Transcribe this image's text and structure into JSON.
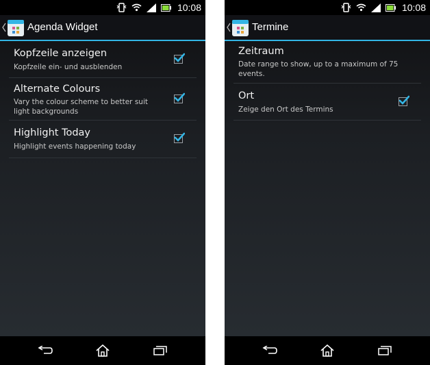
{
  "status_bar": {
    "time": "10:08"
  },
  "left_screen": {
    "title": "Agenda Widget",
    "items": [
      {
        "title": "Kopfzeile anzeigen",
        "subtitle": "Kopfzeile ein- und ausblenden",
        "checked": true
      },
      {
        "title": "Alternate Colours",
        "subtitle": "Vary the colour scheme to better suit light backgrounds",
        "checked": true
      },
      {
        "title": "Highlight Today",
        "subtitle": "Highlight events happening today",
        "checked": true
      }
    ]
  },
  "right_screen": {
    "title": "Termine",
    "items": [
      {
        "title": "Zeitraum",
        "subtitle": "Date range to show, up to a maximum of 75 events."
      },
      {
        "title": "Ort",
        "subtitle": "Zeige den Ort des Termins",
        "checked": true
      }
    ]
  },
  "colors": {
    "accent": "#33b5e5",
    "check": "#33b5e5"
  },
  "icons": [
    "vibrate-icon",
    "wifi-icon",
    "signal-icon",
    "battery-icon",
    "back-icon",
    "home-icon",
    "recent-apps-icon",
    "app-calendar-icon",
    "chevron-left-icon",
    "checkmark-icon"
  ]
}
